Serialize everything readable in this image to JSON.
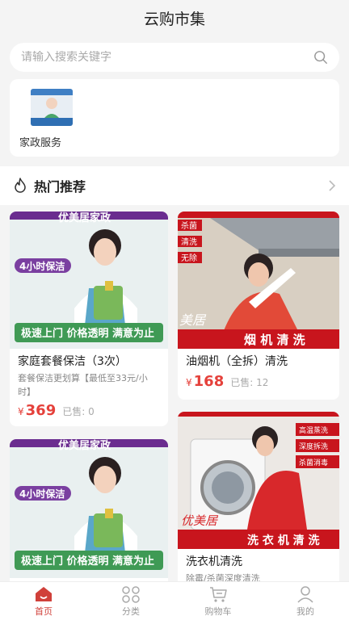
{
  "header": {
    "title": "云购市集"
  },
  "search": {
    "placeholder": "请输入搜索关键字"
  },
  "categories": [
    {
      "label": "家政服务",
      "icon": "housekeeping-thumb"
    }
  ],
  "hot": {
    "title": "热门推荐",
    "icon": "flame-icon"
  },
  "banners": {
    "cleaning": {
      "brand": "优美居家政",
      "badge": "4小时保洁",
      "slogan": "极速上门 价格透明 满意为止"
    },
    "hood": {
      "tags": [
        "杀菌",
        "清洗",
        "无除"
      ],
      "brand": "美居",
      "caption": "烟 机 清 洗"
    },
    "washer": {
      "tags": [
        "高温蒸洗",
        "深度拆洗",
        "杀菌消毒"
      ],
      "brand": "优美居",
      "caption": "洗 衣 机 清 洗"
    }
  },
  "products": [
    {
      "title": "家庭套餐保洁（3次）",
      "desc": "套餐保洁更划算【最低至33元/小时】",
      "currency": "¥",
      "price": "369",
      "sold": "已售: 0"
    },
    {
      "title": "油烟机（全拆）清洗",
      "desc": "",
      "currency": "¥",
      "price": "168",
      "sold": "已售: 12"
    },
    {
      "title": "",
      "desc": "",
      "currency": "",
      "price": "",
      "sold": ""
    },
    {
      "title": "洗衣机清洗",
      "desc": "除霉/杀菌深度清洗",
      "currency": "",
      "price": "",
      "sold": ""
    }
  ],
  "tabbar": [
    {
      "label": "首页",
      "icon": "home-icon",
      "active": true
    },
    {
      "label": "分类",
      "icon": "category-icon",
      "active": false
    },
    {
      "label": "购物车",
      "icon": "cart-icon",
      "active": false
    },
    {
      "label": "我的",
      "icon": "user-icon",
      "active": false
    }
  ],
  "colors": {
    "accent": "#e5413b",
    "tab_active": "#d0403a",
    "banner_purple": "#6a2c8f",
    "banner_red": "#c8151d"
  }
}
